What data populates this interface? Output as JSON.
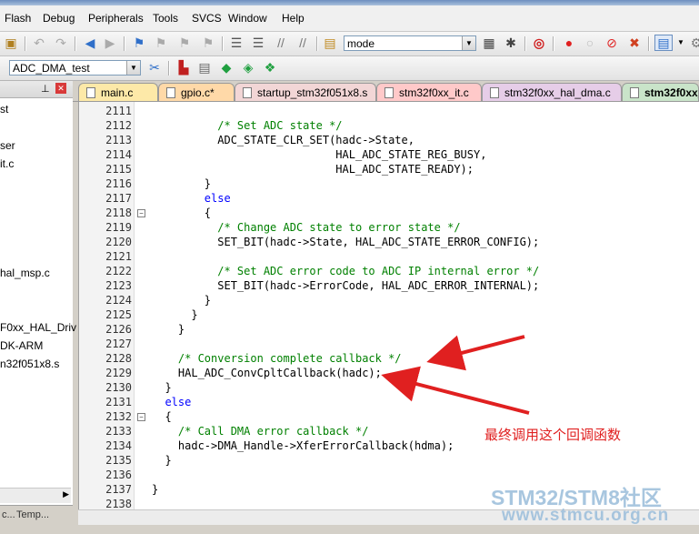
{
  "menu": {
    "items": [
      "Flash",
      "Debug",
      "Peripherals",
      "Tools",
      "SVCS",
      "Window",
      "Help"
    ]
  },
  "toolbar": {
    "find_value": "mode",
    "target_value": "ADC_DMA_test"
  },
  "left_panel": {
    "items": [
      "st",
      "ser",
      "it.c",
      "hal_msp.c",
      "F0xx_HAL_Driv",
      "DK-ARM",
      "n32f051x8.s"
    ],
    "bottom_tabs": [
      "Temp..."
    ]
  },
  "tabs": [
    {
      "label": "main.c"
    },
    {
      "label": "gpio.c*"
    },
    {
      "label": "startup_stm32f051x8.s"
    },
    {
      "label": "stm32f0xx_it.c"
    },
    {
      "label": "stm32f0xx_hal_dma.c"
    },
    {
      "label": "stm32f0xx_"
    }
  ],
  "editor": {
    "lines": [
      {
        "n": "2111",
        "t": ""
      },
      {
        "n": "2112",
        "t": "          /* Set ADC state */",
        "c": "cmt"
      },
      {
        "n": "2113",
        "t": "          ADC_STATE_CLR_SET(hadc->State,"
      },
      {
        "n": "2114",
        "t": "                            HAL_ADC_STATE_REG_BUSY,"
      },
      {
        "n": "2115",
        "t": "                            HAL_ADC_STATE_READY);"
      },
      {
        "n": "2116",
        "t": "        }"
      },
      {
        "n": "2117",
        "t": "        else",
        "c": "kw"
      },
      {
        "n": "2118",
        "t": "        {"
      },
      {
        "n": "2119",
        "t": "          /* Change ADC state to error state */",
        "c": "cmt"
      },
      {
        "n": "2120",
        "t": "          SET_BIT(hadc->State, HAL_ADC_STATE_ERROR_CONFIG);"
      },
      {
        "n": "2121",
        "t": ""
      },
      {
        "n": "2122",
        "t": "          /* Set ADC error code to ADC IP internal error */",
        "c": "cmt"
      },
      {
        "n": "2123",
        "t": "          SET_BIT(hadc->ErrorCode, HAL_ADC_ERROR_INTERNAL);"
      },
      {
        "n": "2124",
        "t": "        }"
      },
      {
        "n": "2125",
        "t": "      }"
      },
      {
        "n": "2126",
        "t": "    }"
      },
      {
        "n": "2127",
        "t": ""
      },
      {
        "n": "2128",
        "t": "    /* Conversion complete callback */",
        "c": "cmt"
      },
      {
        "n": "2129",
        "t": "    HAL_ADC_ConvCpltCallback(hadc);"
      },
      {
        "n": "2130",
        "t": "  }"
      },
      {
        "n": "2131",
        "t": "  else",
        "c": "kw"
      },
      {
        "n": "2132",
        "t": "  {"
      },
      {
        "n": "2133",
        "t": "    /* Call DMA error callback */",
        "c": "cmt"
      },
      {
        "n": "2134",
        "t": "    hadc->DMA_Handle->XferErrorCallback(hdma);"
      },
      {
        "n": "2135",
        "t": "  }"
      },
      {
        "n": "2136",
        "t": ""
      },
      {
        "n": "2137",
        "t": "}"
      },
      {
        "n": "2138",
        "t": ""
      }
    ]
  },
  "annotation": {
    "text": "最终调用这个回调函数",
    "color": "#e02020"
  },
  "watermark": {
    "line1": "STM32/STM8社区",
    "line2": "www.stmcu.org.cn"
  }
}
